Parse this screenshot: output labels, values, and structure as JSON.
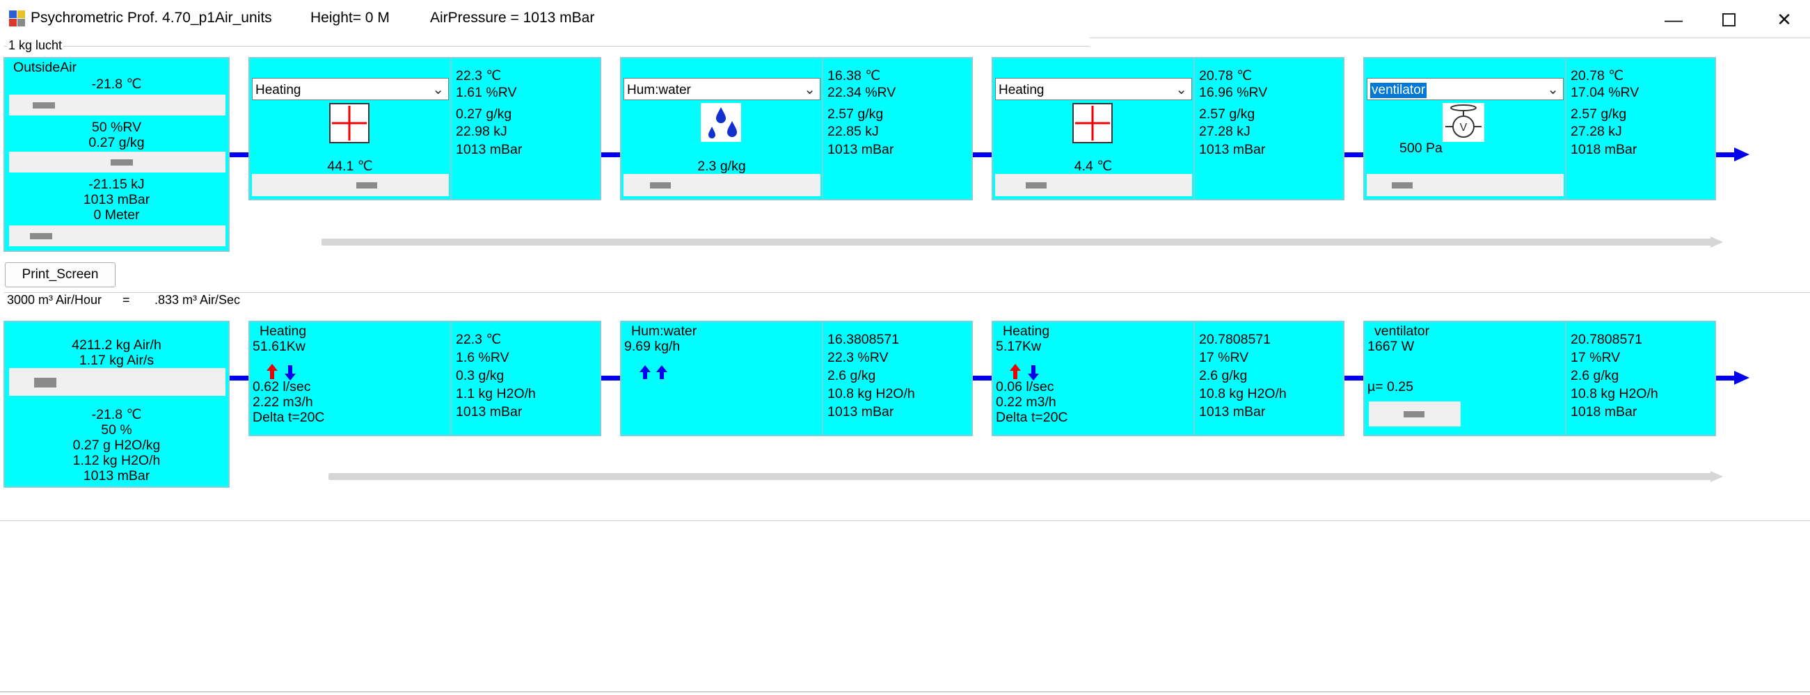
{
  "window": {
    "title": "Psychrometric Prof. 4.70_p1Air_units",
    "height_text": "Height= 0  M",
    "pressure_text": "AirPressure = 1013 mBar"
  },
  "top": {
    "group_label": "1 kg lucht",
    "outside": {
      "label": "OutsideAir",
      "temp": "-21.8 ℃",
      "rh": "50 %RV",
      "moisture": "0.27 g/kg",
      "enthalpy": "-21.15 kJ",
      "pressure": "1013 mBar",
      "height": "0 Meter"
    },
    "units": [
      {
        "select": "Heating",
        "icon": "heater-cross-icon",
        "setpoint": "44.1 ℃",
        "out": [
          "22.3 ℃",
          "1.61 %RV",
          "0.27 g/kg",
          "22.98 kJ",
          "1013 mBar"
        ]
      },
      {
        "select": "Hum:water",
        "icon": "water-drops-icon",
        "setpoint": "2.3 g/kg",
        "out": [
          "16.38 ℃",
          "22.34 %RV",
          "2.57 g/kg",
          "22.85 kJ",
          "1013 mBar"
        ]
      },
      {
        "select": "Heating",
        "icon": "heater-cross-icon",
        "setpoint": "4.4 ℃",
        "out": [
          "20.78 ℃",
          "16.96 %RV",
          "2.57 g/kg",
          "27.28 kJ",
          "1013 mBar"
        ]
      },
      {
        "select": "ventilator",
        "icon": "fan-icon",
        "setpoint": "500 Pa",
        "out": [
          "20.78 ℃",
          "17.04 %RV",
          "2.57 g/kg",
          "27.28 kJ",
          "1018 mBar"
        ]
      }
    ]
  },
  "print_button": "Print_Screen",
  "bottom": {
    "flow_hour": "3000 m³ Air/Hour",
    "equals": "=",
    "flow_sec": ".833 m³ Air/Sec",
    "outside": {
      "mass_h": "4211.2 kg Air/h",
      "mass_s": "1.17 kg Air/s",
      "temp": "-21.8 ℃",
      "rh": "50 %",
      "moisture": "0.27 g H2O/kg",
      "water": "1.12 kg H2O/h",
      "pressure": "1013 mBar"
    },
    "units": [
      {
        "title": "Heating",
        "lines": [
          "51.61Kw",
          "0.62 l/sec",
          "2.22 m3/h",
          "Delta t=20C"
        ],
        "out": [
          "22.3 ℃",
          "1.6 %RV",
          "0.3 g/kg",
          "1.1 kg H2O/h",
          "1013 mBar"
        ]
      },
      {
        "title": "Hum:water",
        "lines": [
          "9.69 kg/h"
        ],
        "out": [
          "16.3808571",
          "22.3 %RV",
          "2.6 g/kg",
          "10.8 kg H2O/h",
          "1013 mBar"
        ]
      },
      {
        "title": "Heating",
        "lines": [
          "5.17Kw",
          "0.06 l/sec",
          "0.22 m3/h",
          "Delta t=20C"
        ],
        "out": [
          "20.7808571",
          "17 %RV",
          "2.6 g/kg",
          "10.8 kg H2O/h",
          "1013 mBar"
        ]
      },
      {
        "title": "ventilator",
        "lines": [
          "1667 W",
          "µ= 0.25"
        ],
        "out": [
          "20.7808571",
          "17 %RV",
          "2.6 g/kg",
          "10.8 kg H2O/h",
          "1018 mBar"
        ]
      }
    ]
  },
  "colors": {
    "panel": "#00ffff",
    "flow": "#0000ee",
    "heat_up": "#ee0000"
  }
}
